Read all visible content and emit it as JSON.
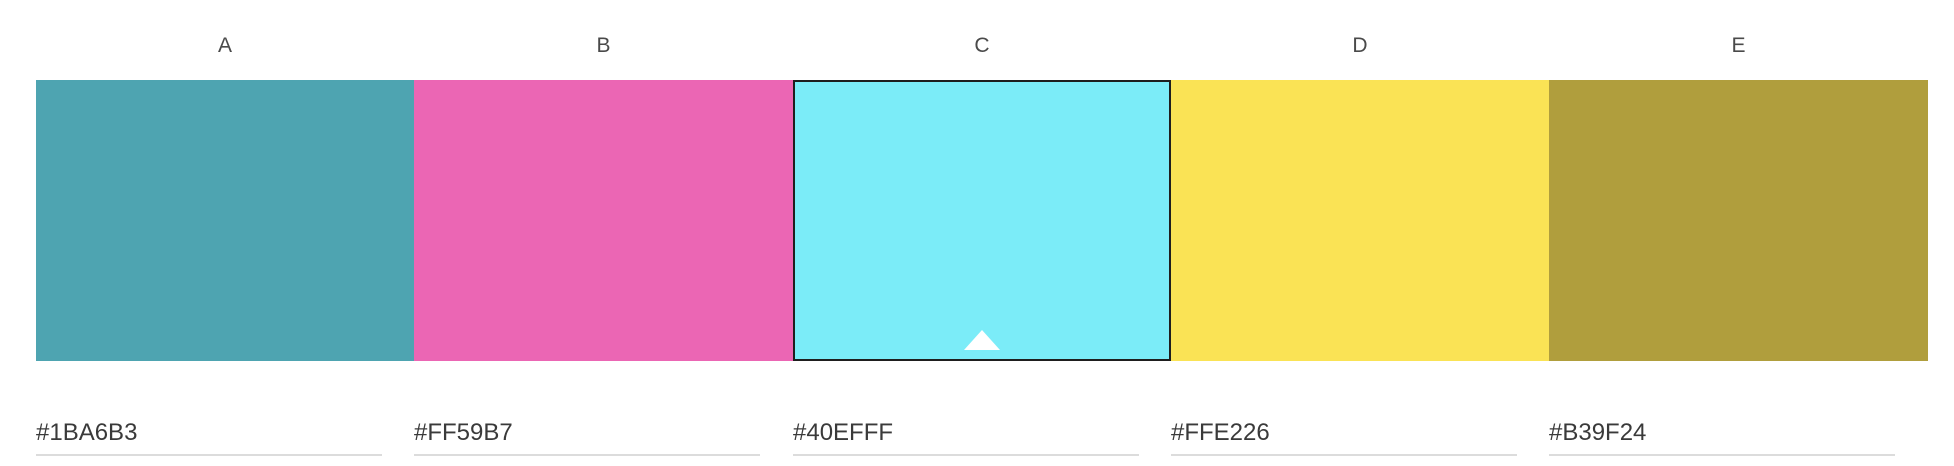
{
  "palette": {
    "selected_index": 2,
    "swatches": [
      {
        "letter": "A",
        "hex": "#1BA6B3",
        "display_color": "#4EA4B1"
      },
      {
        "letter": "B",
        "hex": "#FF59B7",
        "display_color": "#EB66B4"
      },
      {
        "letter": "C",
        "hex": "#40EFFF",
        "display_color": "#7BECF8"
      },
      {
        "letter": "D",
        "hex": "#FFE226",
        "display_color": "#FAE355"
      },
      {
        "letter": "E",
        "hex": "#B39F24",
        "display_color": "#B09E3D"
      }
    ]
  },
  "colors": {
    "selected_border": "#1E1E1E",
    "marker": "#FFFFFF",
    "input_underline": "#DCDCDC",
    "text": "#3A3A3A"
  }
}
